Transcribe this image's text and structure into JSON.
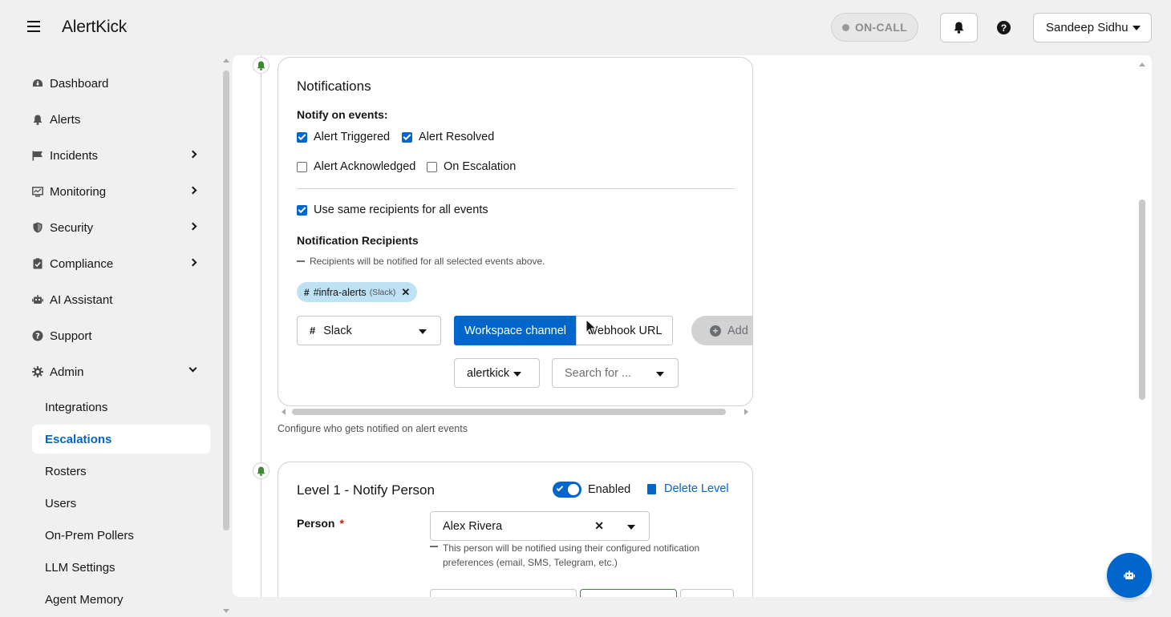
{
  "header": {
    "app_name": "AlertKick",
    "oncall_label": "ON-CALL",
    "user_name": "Sandeep Sidhu"
  },
  "sidebar": {
    "items": [
      {
        "label": "Dashboard",
        "icon": "dashboard-icon"
      },
      {
        "label": "Alerts",
        "icon": "bell-icon"
      },
      {
        "label": "Incidents",
        "icon": "flag-icon",
        "expandable": true
      },
      {
        "label": "Monitoring",
        "icon": "monitor-icon",
        "expandable": true
      },
      {
        "label": "Security",
        "icon": "shield-icon",
        "expandable": true
      },
      {
        "label": "Compliance",
        "icon": "clipboard-check-icon",
        "expandable": true
      },
      {
        "label": "AI Assistant",
        "icon": "robot-icon"
      },
      {
        "label": "Support",
        "icon": "question-circle-icon"
      },
      {
        "label": "Admin",
        "icon": "gear-icon",
        "expanded": true
      }
    ],
    "admin_subitems": [
      {
        "label": "Integrations"
      },
      {
        "label": "Escalations",
        "active": true
      },
      {
        "label": "Rosters"
      },
      {
        "label": "Users"
      },
      {
        "label": "On-Prem Pollers"
      },
      {
        "label": "LLM Settings"
      },
      {
        "label": "Agent Memory"
      }
    ]
  },
  "notifications": {
    "title": "Notifications",
    "notify_on_label": "Notify on events:",
    "events": [
      {
        "label": "Alert Triggered",
        "checked": true
      },
      {
        "label": "Alert Resolved",
        "checked": true
      },
      {
        "label": "Alert Acknowledged",
        "checked": false
      },
      {
        "label": "On Escalation",
        "checked": false
      }
    ],
    "same_recipients": {
      "label": "Use same recipients for all events",
      "checked": true
    },
    "recipients_title": "Notification Recipients",
    "recipients_helper": "Recipients will be notified for all selected events above.",
    "chip": {
      "name": "#infra-alerts",
      "type": "(Slack)"
    },
    "channel_select": "Slack",
    "mode_active": "Workspace channel",
    "mode_inactive": "Webhook URL",
    "add_label": "Add",
    "workspace_select": "alertkick",
    "search_placeholder": "Search for ...",
    "caption": "Configure who gets notified on alert events"
  },
  "level1": {
    "title": "Level 1 - Notify Person",
    "enabled_label": "Enabled",
    "enabled": true,
    "delete_label": "Delete Level",
    "person_label": "Person",
    "required_mark": "*",
    "person_value": "Alex Rivera",
    "person_helper": "This person will be notified using their configured notification preferences (email, SMS, Telegram, etc.)"
  },
  "colors": {
    "accent": "#0066cc",
    "timeline_bell": "#3e8635",
    "chip_bg": "#bee1f4"
  }
}
